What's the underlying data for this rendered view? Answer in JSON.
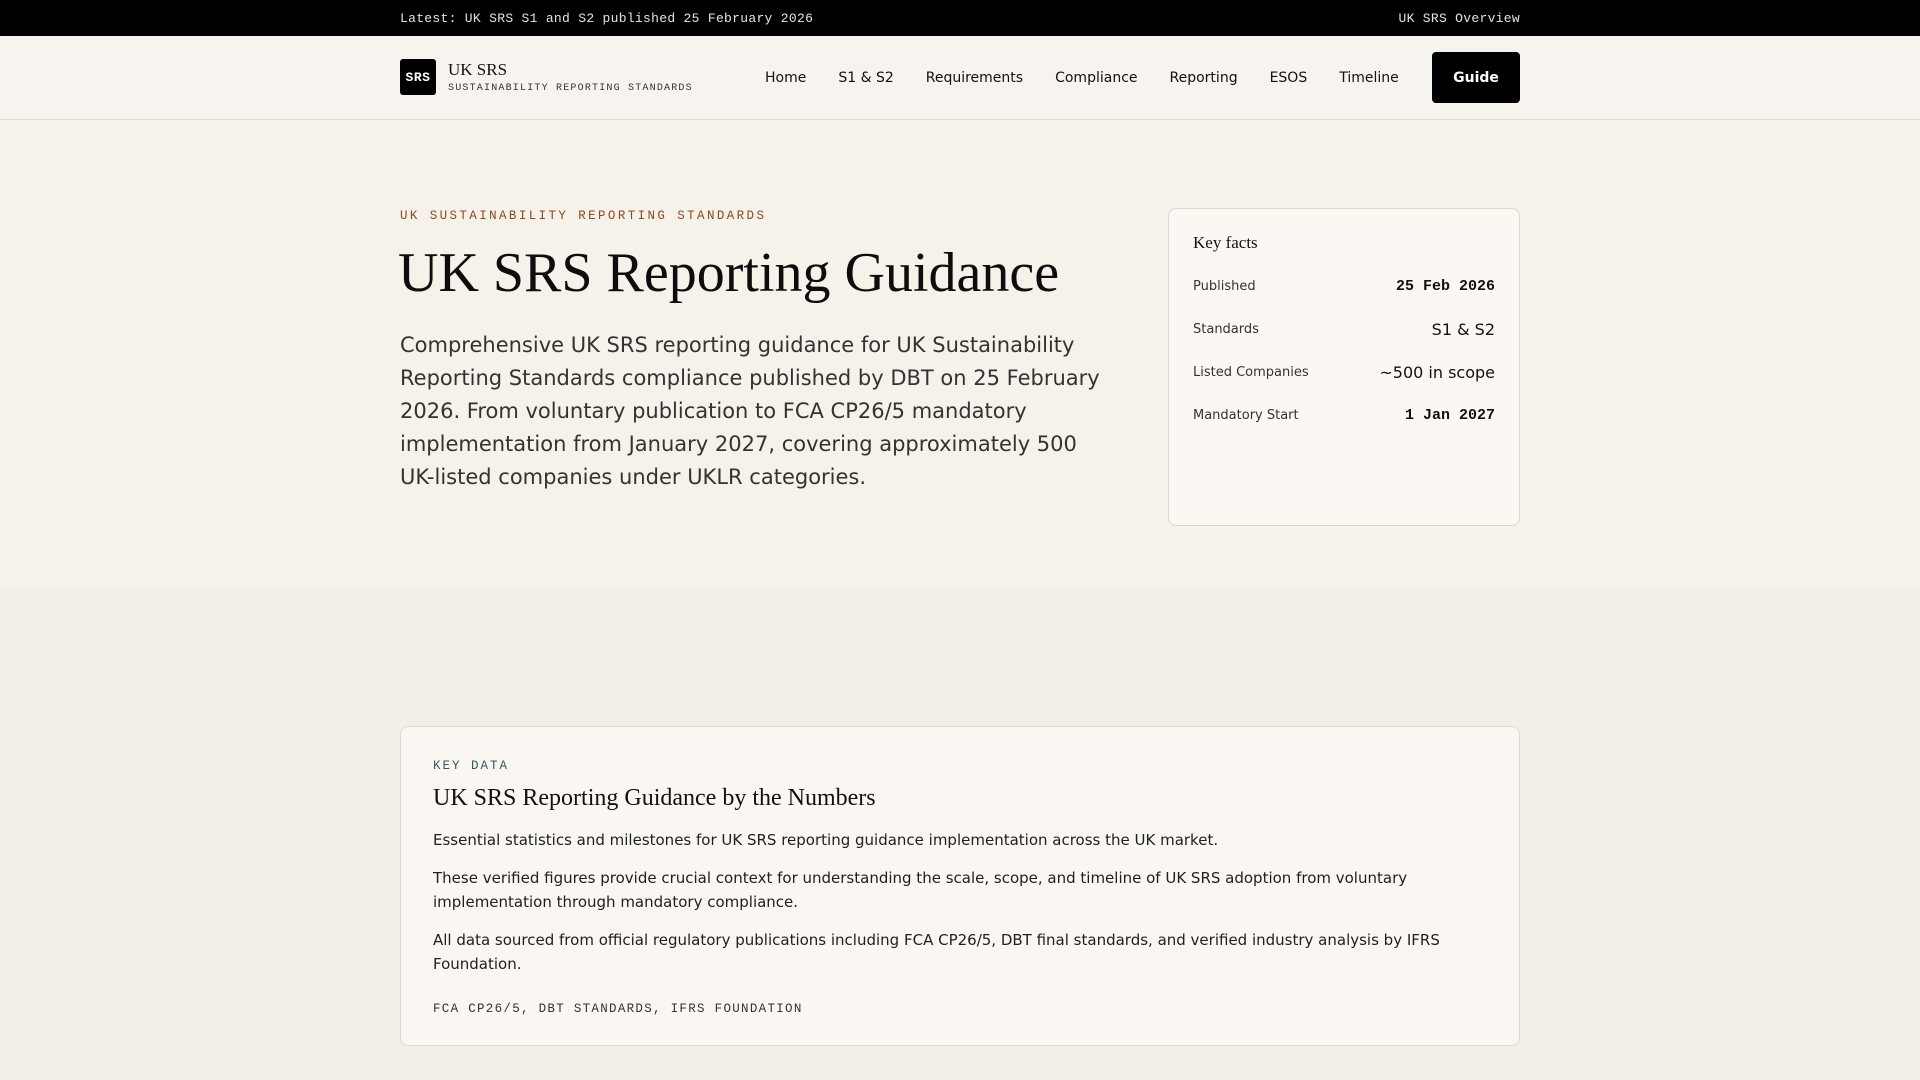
{
  "topbar": {
    "announcement": "Latest: UK SRS S1 and S2 published 25 February 2026",
    "overview_link": "UK SRS Overview"
  },
  "header": {
    "logo_badge": "SRS",
    "logo_title": "UK SRS",
    "logo_subtitle": "SUSTAINABILITY REPORTING STANDARDS",
    "nav": [
      {
        "label": "Home"
      },
      {
        "label": "S1 & S2"
      },
      {
        "label": "Requirements"
      },
      {
        "label": "Compliance"
      },
      {
        "label": "Reporting"
      },
      {
        "label": "ESOS"
      },
      {
        "label": "Timeline"
      }
    ],
    "cta_label": "Guide"
  },
  "hero": {
    "kicker": "UK SUSTAINABILITY REPORTING STANDARDS",
    "title": "UK SRS Reporting Guidance",
    "description": "Comprehensive UK SRS reporting guidance for UK Sustainability Reporting Standards compliance published by DBT on 25 February 2026. From voluntary publication to FCA CP26/5 mandatory implementation from January 2027, covering approximately 500 UK-listed companies under UKLR categories."
  },
  "key_facts": {
    "title": "Key facts",
    "rows": [
      {
        "label": "Published",
        "value": "25 Feb 2026"
      },
      {
        "label": "Standards",
        "value": "S1 & S2"
      },
      {
        "label": "Listed Companies",
        "value": "~500 in scope"
      },
      {
        "label": "Mandatory Start",
        "value": "1 Jan 2027"
      }
    ]
  },
  "key_data": {
    "kicker": "KEY DATA",
    "title": "UK SRS Reporting Guidance by the Numbers",
    "paragraphs": [
      "Essential statistics and milestones for UK SRS reporting guidance implementation across the UK market.",
      "These verified figures provide crucial context for understanding the scale, scope, and timeline of UK SRS adoption from voluntary implementation through mandatory compliance.",
      "All data sourced from official regulatory publications including FCA CP26/5, DBT final standards, and verified industry analysis by IFRS Foundation."
    ],
    "sources": "FCA CP26/5, DBT STANDARDS, IFRS FOUNDATION"
  }
}
